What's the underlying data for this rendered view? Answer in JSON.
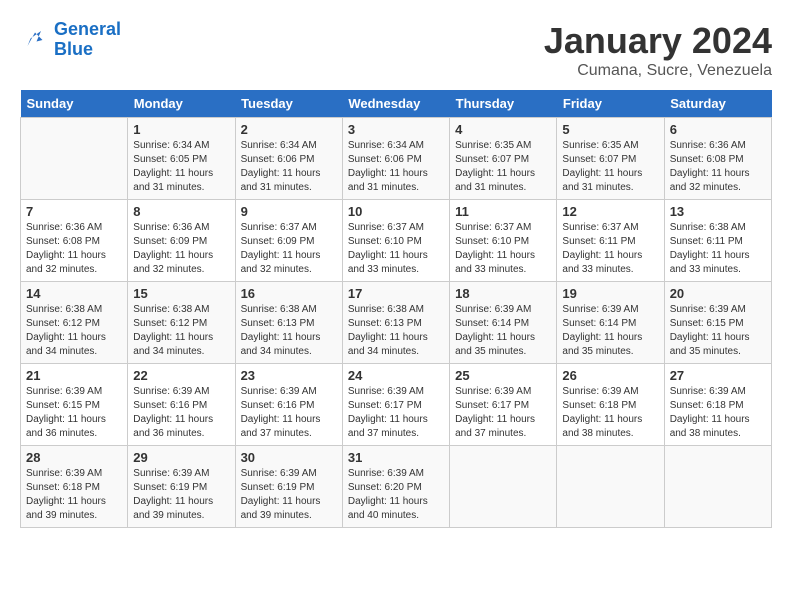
{
  "header": {
    "logo_line1": "General",
    "logo_line2": "Blue",
    "month_title": "January 2024",
    "subtitle": "Cumana, Sucre, Venezuela"
  },
  "days_of_week": [
    "Sunday",
    "Monday",
    "Tuesday",
    "Wednesday",
    "Thursday",
    "Friday",
    "Saturday"
  ],
  "weeks": [
    [
      {
        "day": "",
        "info": ""
      },
      {
        "day": "1",
        "info": "Sunrise: 6:34 AM\nSunset: 6:05 PM\nDaylight: 11 hours\nand 31 minutes."
      },
      {
        "day": "2",
        "info": "Sunrise: 6:34 AM\nSunset: 6:06 PM\nDaylight: 11 hours\nand 31 minutes."
      },
      {
        "day": "3",
        "info": "Sunrise: 6:34 AM\nSunset: 6:06 PM\nDaylight: 11 hours\nand 31 minutes."
      },
      {
        "day": "4",
        "info": "Sunrise: 6:35 AM\nSunset: 6:07 PM\nDaylight: 11 hours\nand 31 minutes."
      },
      {
        "day": "5",
        "info": "Sunrise: 6:35 AM\nSunset: 6:07 PM\nDaylight: 11 hours\nand 31 minutes."
      },
      {
        "day": "6",
        "info": "Sunrise: 6:36 AM\nSunset: 6:08 PM\nDaylight: 11 hours\nand 32 minutes."
      }
    ],
    [
      {
        "day": "7",
        "info": "Sunrise: 6:36 AM\nSunset: 6:08 PM\nDaylight: 11 hours\nand 32 minutes."
      },
      {
        "day": "8",
        "info": "Sunrise: 6:36 AM\nSunset: 6:09 PM\nDaylight: 11 hours\nand 32 minutes."
      },
      {
        "day": "9",
        "info": "Sunrise: 6:37 AM\nSunset: 6:09 PM\nDaylight: 11 hours\nand 32 minutes."
      },
      {
        "day": "10",
        "info": "Sunrise: 6:37 AM\nSunset: 6:10 PM\nDaylight: 11 hours\nand 33 minutes."
      },
      {
        "day": "11",
        "info": "Sunrise: 6:37 AM\nSunset: 6:10 PM\nDaylight: 11 hours\nand 33 minutes."
      },
      {
        "day": "12",
        "info": "Sunrise: 6:37 AM\nSunset: 6:11 PM\nDaylight: 11 hours\nand 33 minutes."
      },
      {
        "day": "13",
        "info": "Sunrise: 6:38 AM\nSunset: 6:11 PM\nDaylight: 11 hours\nand 33 minutes."
      }
    ],
    [
      {
        "day": "14",
        "info": "Sunrise: 6:38 AM\nSunset: 6:12 PM\nDaylight: 11 hours\nand 34 minutes."
      },
      {
        "day": "15",
        "info": "Sunrise: 6:38 AM\nSunset: 6:12 PM\nDaylight: 11 hours\nand 34 minutes."
      },
      {
        "day": "16",
        "info": "Sunrise: 6:38 AM\nSunset: 6:13 PM\nDaylight: 11 hours\nand 34 minutes."
      },
      {
        "day": "17",
        "info": "Sunrise: 6:38 AM\nSunset: 6:13 PM\nDaylight: 11 hours\nand 34 minutes."
      },
      {
        "day": "18",
        "info": "Sunrise: 6:39 AM\nSunset: 6:14 PM\nDaylight: 11 hours\nand 35 minutes."
      },
      {
        "day": "19",
        "info": "Sunrise: 6:39 AM\nSunset: 6:14 PM\nDaylight: 11 hours\nand 35 minutes."
      },
      {
        "day": "20",
        "info": "Sunrise: 6:39 AM\nSunset: 6:15 PM\nDaylight: 11 hours\nand 35 minutes."
      }
    ],
    [
      {
        "day": "21",
        "info": "Sunrise: 6:39 AM\nSunset: 6:15 PM\nDaylight: 11 hours\nand 36 minutes."
      },
      {
        "day": "22",
        "info": "Sunrise: 6:39 AM\nSunset: 6:16 PM\nDaylight: 11 hours\nand 36 minutes."
      },
      {
        "day": "23",
        "info": "Sunrise: 6:39 AM\nSunset: 6:16 PM\nDaylight: 11 hours\nand 37 minutes."
      },
      {
        "day": "24",
        "info": "Sunrise: 6:39 AM\nSunset: 6:17 PM\nDaylight: 11 hours\nand 37 minutes."
      },
      {
        "day": "25",
        "info": "Sunrise: 6:39 AM\nSunset: 6:17 PM\nDaylight: 11 hours\nand 37 minutes."
      },
      {
        "day": "26",
        "info": "Sunrise: 6:39 AM\nSunset: 6:18 PM\nDaylight: 11 hours\nand 38 minutes."
      },
      {
        "day": "27",
        "info": "Sunrise: 6:39 AM\nSunset: 6:18 PM\nDaylight: 11 hours\nand 38 minutes."
      }
    ],
    [
      {
        "day": "28",
        "info": "Sunrise: 6:39 AM\nSunset: 6:18 PM\nDaylight: 11 hours\nand 39 minutes."
      },
      {
        "day": "29",
        "info": "Sunrise: 6:39 AM\nSunset: 6:19 PM\nDaylight: 11 hours\nand 39 minutes."
      },
      {
        "day": "30",
        "info": "Sunrise: 6:39 AM\nSunset: 6:19 PM\nDaylight: 11 hours\nand 39 minutes."
      },
      {
        "day": "31",
        "info": "Sunrise: 6:39 AM\nSunset: 6:20 PM\nDaylight: 11 hours\nand 40 minutes."
      },
      {
        "day": "",
        "info": ""
      },
      {
        "day": "",
        "info": ""
      },
      {
        "day": "",
        "info": ""
      }
    ]
  ]
}
